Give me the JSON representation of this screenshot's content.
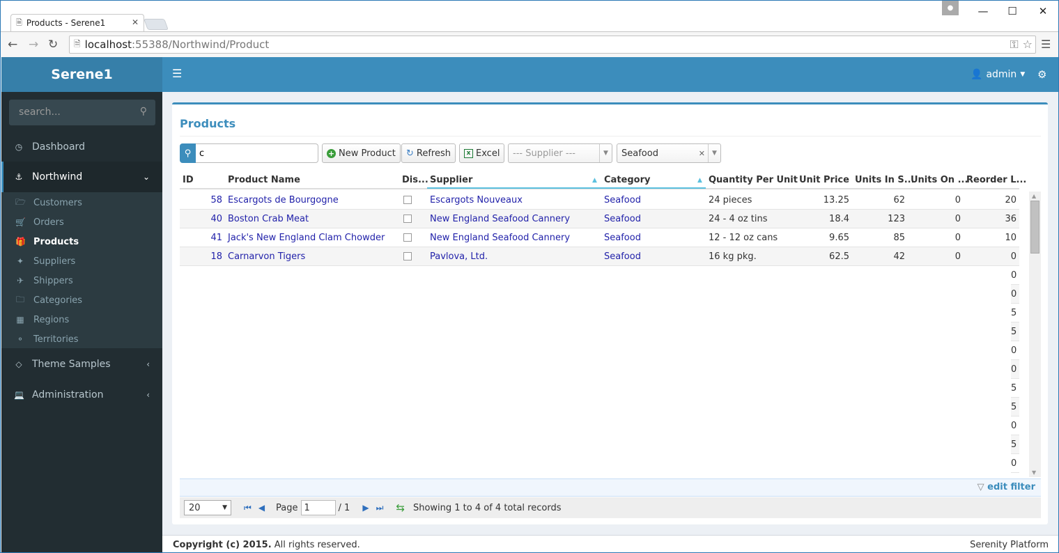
{
  "browser": {
    "tab_title": "Products - Serene1",
    "url_host": "localhost",
    "url_rest": ":55388/Northwind/Product"
  },
  "app": {
    "logo": "Serene1",
    "user": "admin"
  },
  "sidebar": {
    "search_placeholder": "search...",
    "items": [
      {
        "label": "Dashboard",
        "icon": "dashboard-icon"
      },
      {
        "label": "Northwind",
        "icon": "anchor-icon"
      },
      {
        "label": "Theme Samples",
        "icon": "diamond-icon"
      },
      {
        "label": "Administration",
        "icon": "monitor-icon"
      }
    ],
    "northwind_items": [
      {
        "label": "Customers",
        "icon": "folder-open-icon"
      },
      {
        "label": "Orders",
        "icon": "cart-icon"
      },
      {
        "label": "Products",
        "icon": "gift-icon"
      },
      {
        "label": "Suppliers",
        "icon": "wand-icon"
      },
      {
        "label": "Shippers",
        "icon": "plane-icon"
      },
      {
        "label": "Categories",
        "icon": "folder-icon"
      },
      {
        "label": "Regions",
        "icon": "map-icon"
      },
      {
        "label": "Territories",
        "icon": "tag-icon"
      }
    ]
  },
  "page": {
    "title": "Products",
    "quick_search_value": "c",
    "buttons": {
      "new": "New Product",
      "refresh": "Refresh",
      "excel": "Excel"
    },
    "supplier_filter_placeholder": "--- Supplier ---",
    "category_filter_value": "Seafood"
  },
  "grid": {
    "columns": [
      "ID",
      "Product Name",
      "Dis...",
      "Supplier",
      "Category",
      "Quantity Per Unit",
      "Unit Price",
      "Units In S...",
      "Units On ...",
      "Reorder L..."
    ],
    "rows": [
      {
        "id": "58",
        "name": "Escargots de Bourgogne",
        "supplier": "Escargots Nouveaux",
        "category": "Seafood",
        "qty": "24 pieces",
        "price": "13.25",
        "stock": "62",
        "on_order": "0",
        "reorder": "20"
      },
      {
        "id": "40",
        "name": "Boston Crab Meat",
        "supplier": "New England Seafood Cannery",
        "category": "Seafood",
        "qty": "24 - 4 oz tins",
        "price": "18.4",
        "stock": "123",
        "on_order": "0",
        "reorder": "36"
      },
      {
        "id": "41",
        "name": "Jack's New England Clam Chowder",
        "supplier": "New England Seafood Cannery",
        "category": "Seafood",
        "qty": "12 - 12 oz cans",
        "price": "9.65",
        "stock": "85",
        "on_order": "0",
        "reorder": "10"
      },
      {
        "id": "18",
        "name": "Carnarvon Tigers",
        "supplier": "Pavlova, Ltd.",
        "category": "Seafood",
        "qty": "16 kg pkg.",
        "price": "62.5",
        "stock": "42",
        "on_order": "0",
        "reorder": "0"
      }
    ],
    "ghost_digits": [
      "0",
      "0",
      "5",
      "5",
      "0",
      "0",
      "5",
      "5",
      "0",
      "5",
      "0"
    ]
  },
  "filter": {
    "edit_label": "edit filter"
  },
  "pager": {
    "page_size": "20",
    "page_label": "Page",
    "page_value": "1",
    "total_pages": "/ 1",
    "status": "Showing 1 to 4 of 4 total records"
  },
  "footer": {
    "copyright_bold": "Copyright (c) 2015.",
    "copyright_rest": " All rights reserved.",
    "platform": "Serenity Platform"
  }
}
